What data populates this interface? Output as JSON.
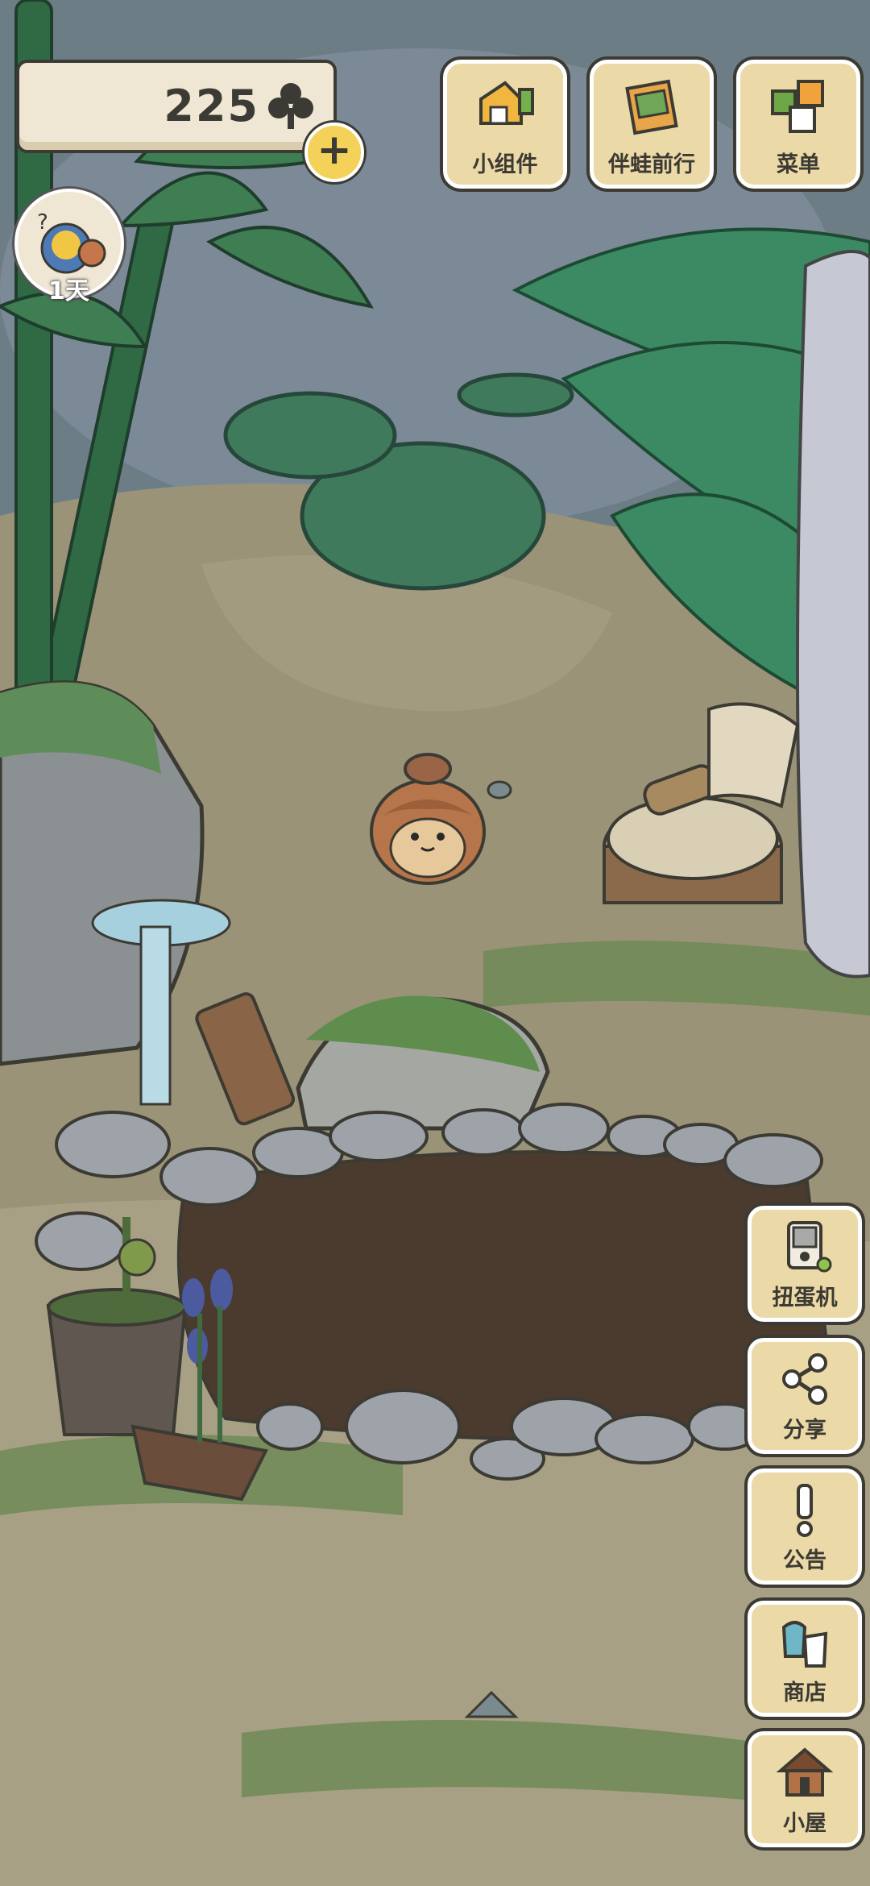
{
  "currency": {
    "amount": "225",
    "icon": "clover-icon",
    "add_icon": "plus-icon"
  },
  "status": {
    "days_label": "1天"
  },
  "top_menu": [
    {
      "label": "小组件",
      "icon": "widget-icon"
    },
    {
      "label": "伴蛙前行",
      "icon": "album-icon"
    },
    {
      "label": "菜单",
      "icon": "menu-icon"
    }
  ],
  "side_menu": [
    {
      "label": "扭蛋机",
      "icon": "gacha-icon"
    },
    {
      "label": "分享",
      "icon": "share-icon"
    },
    {
      "label": "公告",
      "icon": "notice-icon"
    },
    {
      "label": "商店",
      "icon": "shop-icon"
    },
    {
      "label": "小屋",
      "icon": "house-icon"
    }
  ],
  "colors": {
    "button_bg": "#ecd9a8",
    "outline": "#3b3a33",
    "grass": "#6f8c58",
    "soil": "#4a3a2c",
    "coin_yellow": "#f4d25a"
  }
}
